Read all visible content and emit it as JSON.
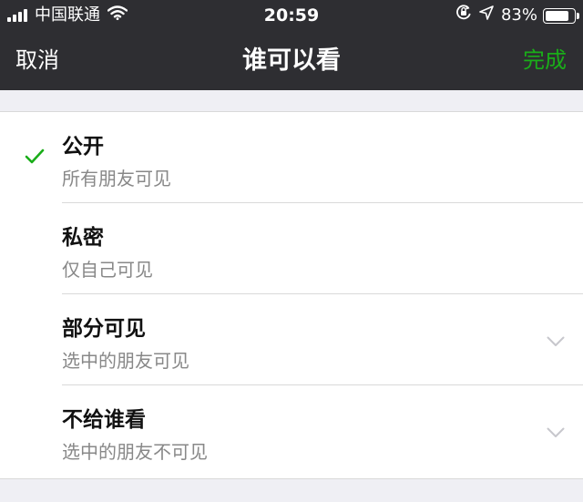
{
  "status_bar": {
    "carrier": "中国联通",
    "time": "20:59",
    "battery": "83%",
    "battery_level": 0.83
  },
  "nav": {
    "cancel_label": "取消",
    "title": "谁可以看",
    "done_label": "完成"
  },
  "options": [
    {
      "title": "公开",
      "subtitle": "所有朋友可见",
      "selected": true,
      "expandable": false
    },
    {
      "title": "私密",
      "subtitle": "仅自己可见",
      "selected": false,
      "expandable": false
    },
    {
      "title": "部分可见",
      "subtitle": "选中的朋友可见",
      "selected": false,
      "expandable": true
    },
    {
      "title": "不给谁看",
      "subtitle": "选中的朋友不可见",
      "selected": false,
      "expandable": true
    }
  ],
  "colors": {
    "accent": "#1aad19",
    "nav_background": "#2e2e32",
    "page_background": "#efeff4"
  },
  "icons": {
    "signal": "signal-bars-icon",
    "wifi": "wifi-icon",
    "rotation_lock": "rotation-lock-icon",
    "location": "location-arrow-icon",
    "battery": "battery-icon",
    "check": "checkmark-icon",
    "chevron": "chevron-down-icon"
  }
}
